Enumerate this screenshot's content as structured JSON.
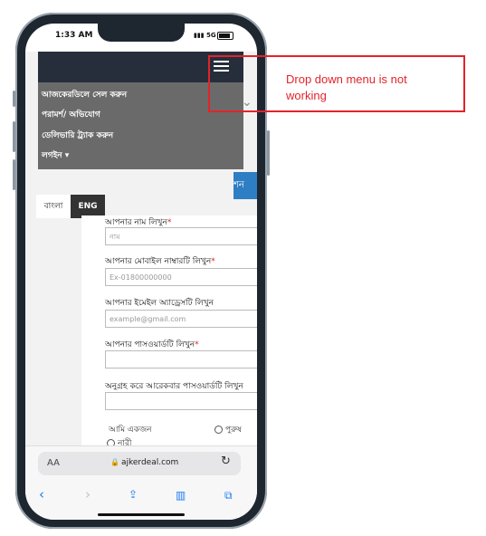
{
  "status_bar": {
    "time": "1:33 AM",
    "network": "5G"
  },
  "nav": {
    "menu_items": [
      {
        "label": "আজকেরডিলে সেল করুন"
      },
      {
        "label": "পরামর্শ/ অভিযোগ"
      },
      {
        "label": "ডেলিভারি ট্র্যাক করুন"
      },
      {
        "label": "লগইন ▾"
      }
    ]
  },
  "partial_heading": "শন",
  "language": {
    "bangla": "বাংলা",
    "english": "ENG"
  },
  "form": {
    "name_label": "আপনার নাম লিখুন",
    "name_placeholder": "নাম",
    "mobile_label": "আপনার মোবাইল নাম্বারটি লিখুন",
    "mobile_placeholder": "Ex-01800000000",
    "email_label": "আপনার ইমেইল অ্যাড্রেসটি লিখুন",
    "email_placeholder": "example@gmail.com",
    "password_label": "আপনার পাসওয়ার্ডটি লিখুন",
    "confirm_label": "অনুগ্রহ করে আরেকবার পাসওয়ার্ডটি লিখুন",
    "gender_label": "আমি একজন",
    "male": "পুরুষ",
    "female": "নারী",
    "required_mark": "*"
  },
  "browser": {
    "aa": "AA",
    "url": "ajkerdeal.com"
  },
  "annotation": {
    "text": "Drop down menu is not working",
    "color": "#e2232b"
  }
}
